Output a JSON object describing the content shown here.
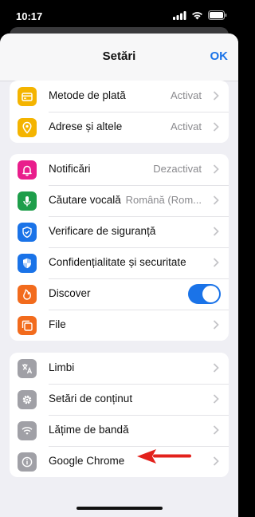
{
  "status_bar": {
    "time": "10:17"
  },
  "header": {
    "title": "Setări",
    "ok_label": "OK"
  },
  "groups": [
    {
      "items": [
        {
          "label": "Metode de plată",
          "value": "Activat",
          "icon": "credit-card-icon",
          "color": "#f4b400"
        },
        {
          "label": "Adrese și altele",
          "value": "Activat",
          "icon": "location-pin-icon",
          "color": "#f4b400"
        }
      ]
    },
    {
      "items": [
        {
          "label": "Notificări",
          "value": "Dezactivat",
          "icon": "bell-icon",
          "color": "#e91e8c"
        },
        {
          "label": "Căutare vocală",
          "value": "Română (Rom...",
          "icon": "microphone-icon",
          "color": "#1e9e4a"
        },
        {
          "label": "Verificare de siguranță",
          "value": "",
          "icon": "shield-check-icon",
          "color": "#1a73e8"
        },
        {
          "label": "Confidențialitate și securitate",
          "value": "",
          "icon": "shield-icon",
          "color": "#1a73e8"
        },
        {
          "label": "Discover",
          "value": "",
          "icon": "flame-icon",
          "color": "#f26b1d",
          "toggle": true
        },
        {
          "label": "File",
          "value": "",
          "icon": "tabs-icon",
          "color": "#f26b1d"
        }
      ]
    },
    {
      "items": [
        {
          "label": "Limbi",
          "value": "",
          "icon": "translate-icon",
          "color": "#a0a0a6"
        },
        {
          "label": "Setări de conținut",
          "value": "",
          "icon": "gear-icon",
          "color": "#a0a0a6"
        },
        {
          "label": "Lățime de bandă",
          "value": "",
          "icon": "wifi-icon",
          "color": "#a0a0a6"
        },
        {
          "label": "Google Chrome",
          "value": "",
          "icon": "info-icon",
          "color": "#a0a0a6"
        }
      ]
    }
  ],
  "colors": {
    "accent": "#1a73e8",
    "annotation_arrow": "#e3211c"
  }
}
